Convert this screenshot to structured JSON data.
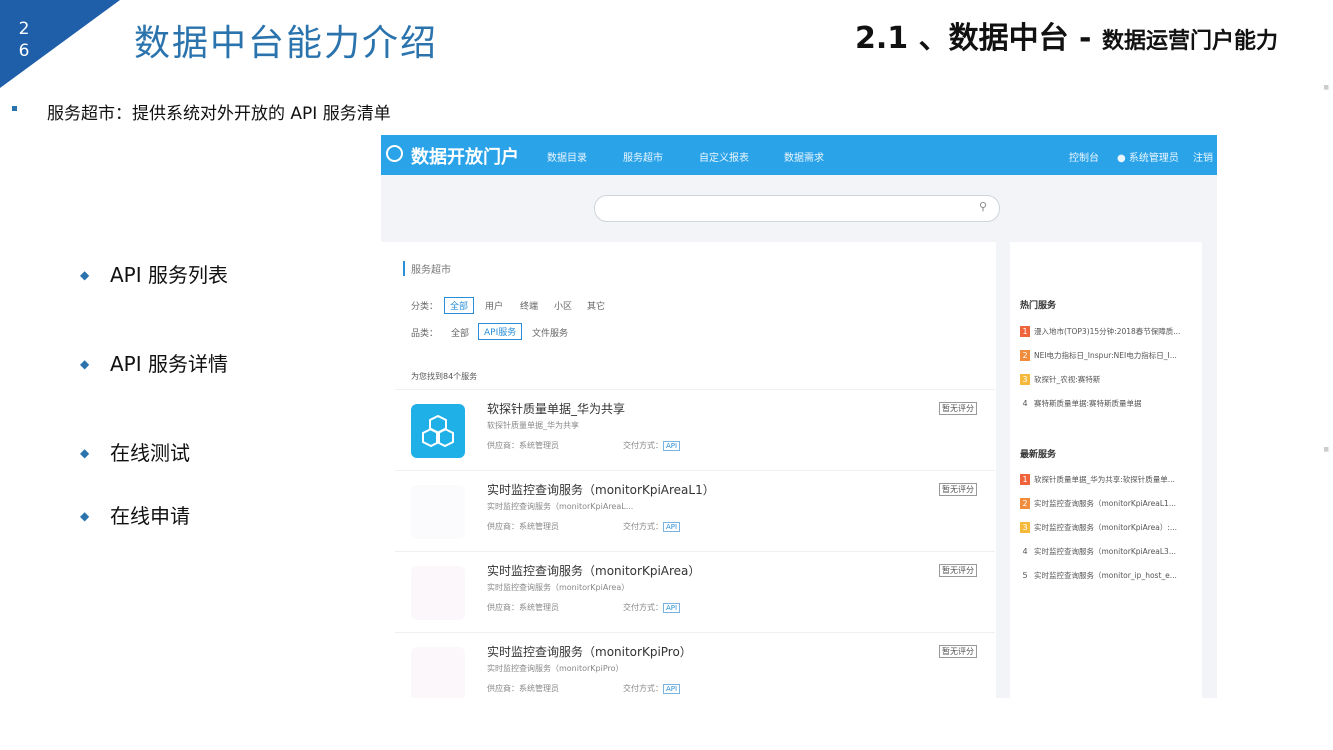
{
  "slide_number": "2\n6",
  "title": "数据中台能力介绍",
  "subtitle_main": "2.1 、数据中台 - ",
  "subtitle_small": "数据运营门户能力",
  "main_bullet": "服务超市：提供系统对外开放的 API 服务清单",
  "sub_bullets": [
    "API 服务列表",
    "API 服务详情",
    "在线测试",
    "在线申请"
  ],
  "portal": {
    "logo": "数据开放门户",
    "nav": [
      "数据目录",
      "服务超市",
      "自定义报表",
      "数据需求"
    ],
    "nav_right": [
      "控制台",
      "系统管理员",
      "注销"
    ],
    "crumb": "服务超市",
    "filter1_label": "分类：",
    "filter1_options": [
      "全部",
      "用户",
      "终端",
      "小区",
      "其它"
    ],
    "filter2_label": "品类：",
    "filter2_options": [
      "全部",
      "API服务",
      "文件服务"
    ],
    "count_text": "为您找到84个服务",
    "services": [
      {
        "name": "软探针质量单据_华为共享",
        "desc": "软探针质量单据_华为共享",
        "provider": "供应商：系统管理员",
        "delivery": "交付方式：",
        "api": "API",
        "rating": "暂无评分"
      },
      {
        "name": "实时监控查询服务（monitorKpiAreaL1）",
        "desc": "实时监控查询服务（monitorKpiAreaL...",
        "provider": "供应商：系统管理员",
        "delivery": "交付方式：",
        "api": "API",
        "rating": "暂无评分"
      },
      {
        "name": "实时监控查询服务（monitorKpiArea）",
        "desc": "实时监控查询服务（monitorKpiArea）",
        "provider": "供应商：系统管理员",
        "delivery": "交付方式：",
        "api": "API",
        "rating": "暂无评分"
      },
      {
        "name": "实时监控查询服务（monitorKpiPro）",
        "desc": "实时监控查询服务（monitorKpiPro）",
        "provider": "供应商：系统管理员",
        "delivery": "交付方式：",
        "api": "API",
        "rating": "暂无评分"
      }
    ],
    "hot_title": "热门服务",
    "hot": [
      {
        "n": "1",
        "text": "漫入地市(TOP3)15分钟:2018春节保障质..."
      },
      {
        "n": "2",
        "text": "NEI电力指标日_Inspur:NEI电力指标日_I..."
      },
      {
        "n": "3",
        "text": "软探针_农视:赛特斯"
      },
      {
        "n": "4",
        "text": "赛特斯质量单据:赛特斯质量单据"
      }
    ],
    "new_title": "最新服务",
    "new": [
      {
        "n": "1",
        "text": "软探针质量单据_华为共享:软探针质量单..."
      },
      {
        "n": "2",
        "text": "实时监控查询服务（monitorKpiAreaL1..."
      },
      {
        "n": "3",
        "text": "实时监控查询服务（monitorKpiArea）:..."
      },
      {
        "n": "4",
        "text": "实时监控查询服务（monitorKpiAreaL3..."
      },
      {
        "n": "5",
        "text": "实时监控查询服务（monitor_ip_host_e..."
      }
    ]
  },
  "colors": {
    "accent": "#2a73ad",
    "nav": "#2aa3e8",
    "rank1": "#f0643c",
    "rank2": "#f08c3c",
    "rank3": "#f5b93c"
  }
}
